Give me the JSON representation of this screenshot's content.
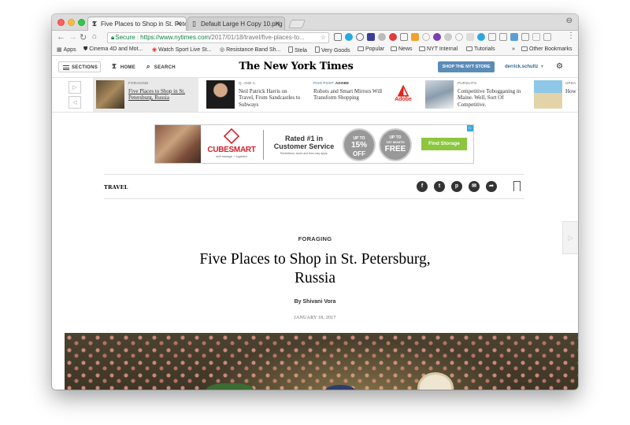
{
  "browser": {
    "tabs": [
      {
        "title": "Five Places to Shop in St. Pete",
        "icon": "nyt-favicon",
        "active": true
      },
      {
        "title": "Default Large H Copy 10.png",
        "icon": "page-icon",
        "active": false
      }
    ],
    "secure_label": "Secure",
    "url_main": "https://www.nytimes.com",
    "url_path": "/2017/01/18/travel/five-places-to...",
    "bookmarks": [
      {
        "label": "Apps",
        "icon": "apps-grid-icon"
      },
      {
        "label": "Cinema 4D and Mot...",
        "icon": "shield-icon"
      },
      {
        "label": "Watch Sport Live St...",
        "icon": "sport-icon"
      },
      {
        "label": "Resistance Band Sh...",
        "icon": "circle-icon"
      },
      {
        "label": "Stela",
        "icon": "page-icon"
      },
      {
        "label": "Very Goods",
        "icon": "page-icon"
      },
      {
        "label": "Popular",
        "icon": "folder-icon"
      },
      {
        "label": "News",
        "icon": "folder-icon"
      },
      {
        "label": "NYT Internal",
        "icon": "folder-icon"
      },
      {
        "label": "Tutorials",
        "icon": "folder-icon"
      },
      {
        "label": "Other Bookmarks",
        "icon": "folder-icon"
      }
    ],
    "more_bookmarks": "»"
  },
  "nyt_header": {
    "sections_label": "SECTIONS",
    "home_label": "HOME",
    "search_label": "SEARCH",
    "logo_text": "The New York Times",
    "shop_label": "SHOP THE NYT STORE",
    "username": "derrick.schultz",
    "username_caret": "▾"
  },
  "ribbon": {
    "items": [
      {
        "kicker": "FORAGING",
        "title": "Five Places to Shop in St. Petersburg, Russia",
        "active": true
      },
      {
        "kicker": "Q. AND A.",
        "title": "Neil Patrick Harris on Travel, From Sandcastles to Subways",
        "active": false
      },
      {
        "kicker_prefix": "PAID POST:",
        "kicker_brand": "ADOBE",
        "title": "Robots and Smart Mirrors Will Transform Shopping",
        "brand_logo_text": "Adobe",
        "active": false
      },
      {
        "kicker": "PURSUITS",
        "title": "Competitive Tobogganing in Maine. Well, Sort Of Competitive.",
        "active": false
      },
      {
        "kicker": "UPDA",
        "title": "How Vaca",
        "active": false
      }
    ]
  },
  "ad": {
    "brand": "CUBESMART",
    "brand_sub": "self storage + logistics",
    "headline_line1": "Rated #1 in",
    "headline_line2": "Customer Service",
    "fineprint": "Restrictions, taxes and fees may apply.",
    "offer1_top": "UP TO",
    "offer1_main": "15%",
    "offer1_bottom": "OFF",
    "offer2_top": "UP TO",
    "offer2_mid": "1ST MONTH",
    "offer2_main": "FREE",
    "cta": "Find Storage",
    "corner_badge": "▷"
  },
  "article": {
    "section": "TRAVEL",
    "kicker": "FORAGING",
    "headline": "Five Places to Shop in St. Petersburg, Russia",
    "byline": "By Shivani Vora",
    "date": "JANUARY 18, 2017",
    "share_icons": [
      "facebook-icon",
      "twitter-icon",
      "pinterest-icon",
      "email-icon",
      "share-icon"
    ]
  },
  "colors": {
    "chrome_bar": "#dcdcdc",
    "secure_green": "#0b8043",
    "nyt_blue": "#5b8cb8",
    "cubesmart_red": "#d6202e",
    "cta_green": "#8cc63f"
  }
}
